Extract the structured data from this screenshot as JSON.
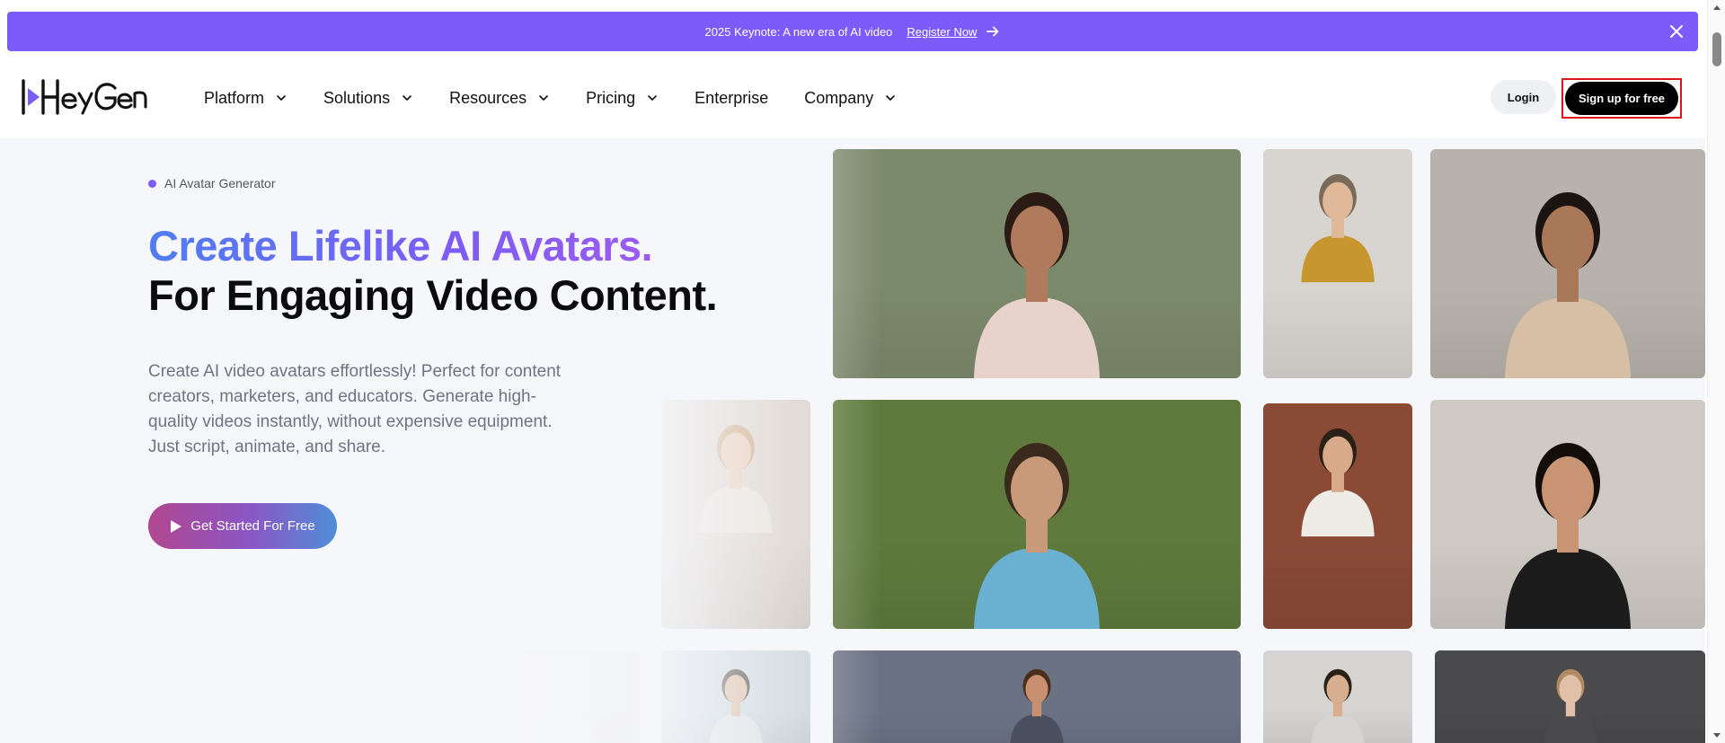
{
  "banner": {
    "message": "2025 Keynote: A new era of AI video",
    "link_label": "Register Now"
  },
  "brand": {
    "name": "HeyGen",
    "accent": "#7b5cfa"
  },
  "nav": {
    "items": [
      {
        "label": "Platform",
        "has_dropdown": true
      },
      {
        "label": "Solutions",
        "has_dropdown": true
      },
      {
        "label": "Resources",
        "has_dropdown": true
      },
      {
        "label": "Pricing",
        "has_dropdown": true
      },
      {
        "label": "Enterprise",
        "has_dropdown": false
      },
      {
        "label": "Company",
        "has_dropdown": true
      }
    ],
    "login_label": "Login",
    "signup_label": "Sign up for free"
  },
  "hero": {
    "eyebrow": "AI Avatar Generator",
    "headline_1": "Create Lifelike AI Avatars.",
    "headline_2": "For Engaging Video Content.",
    "description": "Create AI video avatars effortlessly! Perfect for content creators, marketers, and educators. Generate high-quality videos instantly, without expensive equipment. Just script, animate, and share.",
    "cta_label": "Get Started For Free"
  },
  "gallery": {
    "tiles": [
      {
        "name": "avatar-woman-forest",
        "bg": "#7c8a6c",
        "shirt": "#e8d2cc",
        "skin": "#b07a5c",
        "hair": "#2a1c14"
      },
      {
        "name": "avatar-man-mustard-sweater",
        "bg": "#d8d4cf",
        "shirt": "#c8962e",
        "skin": "#e0b89a",
        "hair": "#7a6a5a"
      },
      {
        "name": "avatar-man-sofa-paintings",
        "bg": "#b8b2ac",
        "shirt": "#d6bfa4",
        "skin": "#a87858",
        "hair": "#1c1410"
      },
      {
        "name": "avatar-woman-blonde",
        "bg": "#d9cfc6",
        "shirt": "#e6dfd6",
        "skin": "#e6c4aa",
        "hair": "#c89a6a"
      },
      {
        "name": "avatar-man-park",
        "bg": "#5f7a3c",
        "shirt": "#6ab0d0",
        "skin": "#c89a7a",
        "hair": "#3a2a1e"
      },
      {
        "name": "avatar-man-brick-wall",
        "bg": "#8a4a36",
        "shirt": "#efece6",
        "skin": "#d8aa8a",
        "hair": "#2a2018"
      },
      {
        "name": "avatar-woman-living-room",
        "bg": "#cfcac4",
        "shirt": "#1c1c1c",
        "skin": "#c89474",
        "hair": "#140e0a"
      },
      {
        "name": "avatar-blinds-partial",
        "bg": "#e6e2dc",
        "shirt": "#e6e2dc",
        "skin": "#e6e2dc",
        "hair": "#e6e2dc"
      },
      {
        "name": "avatar-man-light-bg",
        "bg": "#c6d2d8",
        "shirt": "#d8dde0",
        "skin": "#d6b092",
        "hair": "#2e2620"
      },
      {
        "name": "avatar-woman-city",
        "bg": "#6a7284",
        "shirt": "#4a5060",
        "skin": "#c8906e",
        "hair": "#4a2e1c"
      },
      {
        "name": "avatar-man-white-wall",
        "bg": "#d6d4d2",
        "shirt": "#d6d4d2",
        "skin": "#d8ae90",
        "hair": "#2a2018"
      },
      {
        "name": "avatar-woman-shelf",
        "bg": "#4a4a4c",
        "shirt": "#4a4a4c",
        "skin": "#e0c0a8",
        "hair": "#b08a62"
      }
    ]
  }
}
